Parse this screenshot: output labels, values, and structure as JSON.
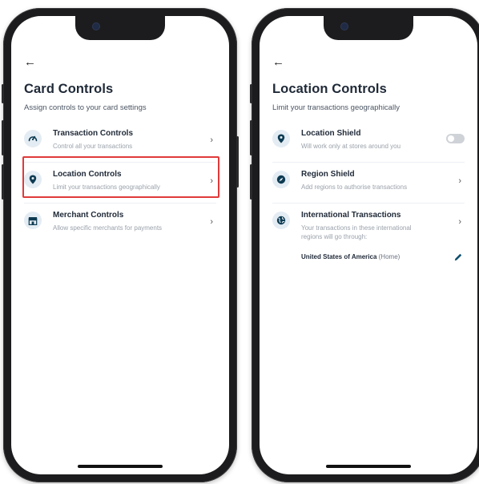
{
  "colors": {
    "icon_fg": "#0d3b52",
    "icon_bg": "#e4ecf3",
    "highlight": "#e03a3a",
    "toggle_off": "#cfd3d8",
    "edit_accent": "#0d4f6e"
  },
  "left_screen": {
    "back_icon": "←",
    "title": "Card Controls",
    "subtitle": "Assign controls to your card settings",
    "items": [
      {
        "icon": "gauge-icon",
        "title": "Transaction Controls",
        "desc": "Control all your transactions",
        "chevron": "›"
      },
      {
        "icon": "location-pin-icon",
        "title": "Location Controls",
        "desc": "Limit your transactions geographically",
        "chevron": "›",
        "highlighted": true
      },
      {
        "icon": "store-icon",
        "title": "Merchant Controls",
        "desc": "Allow specific merchants for payments",
        "chevron": "›"
      }
    ]
  },
  "right_screen": {
    "back_icon": "←",
    "title": "Location Controls",
    "subtitle": "Limit your transactions geographically",
    "items": [
      {
        "icon": "location-pin-icon",
        "title": "Location Shield",
        "desc": "Will work only at stores around you",
        "control": "toggle",
        "toggle_on": false
      },
      {
        "icon": "compass-icon",
        "title": "Region Shield",
        "desc": "Add regions to authorise transactions",
        "chevron": "›"
      },
      {
        "icon": "globe-icon",
        "title": "International Transactions",
        "desc": "Your transactions in these international regions will go through:",
        "chevron": "›",
        "country": "United States of America",
        "country_note": "(Home)",
        "edit_icon": "pencil-icon"
      }
    ]
  }
}
